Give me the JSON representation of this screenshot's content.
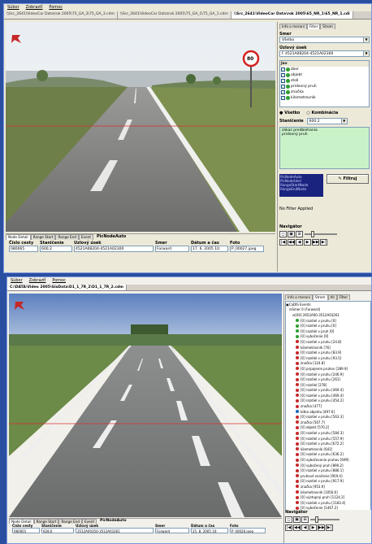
{
  "top_window": {
    "menu": [
      "Súbor",
      "Zobraziť",
      "Pomoc"
    ],
    "tabs": [
      "\\\\Src_2641\\VideoCar Data\\rok 2005\\75_GA_3\\75_GA_3.cdm",
      "\\\\Src_2641\\VideoCar Data\\rok 2005\\75_GA_1\\75_GA_1.cdm",
      "\\\\Src_2641\\VideoCar Data\\rok 2005\\65_NR_1\\65_NR_1.cdi"
    ],
    "panel": {
      "tabs": [
        "Info o meraní",
        "Filter",
        "Strom"
      ],
      "smer_label": "Smer",
      "smer_value": "Všetko",
      "usek_label": "Úzlový úsek",
      "usek_value": "F 4521A08204-4521A02300",
      "jav_header": "Jav",
      "jav_items": [
        "zbor",
        "objekt",
        "stoll",
        "pridavný pruh",
        "značka",
        "kilometrovník"
      ],
      "radio_all": "Všetko",
      "radio_combo": "Kombinácia",
      "staniccenie_label": "Staničenie",
      "staniccenie_value": "600.2",
      "note_lines": [
        "zákaz predbiehania",
        "pridavný pruh"
      ],
      "blue_lines": [
        "PicNodeAuto",
        "PicNodeUzel",
        "RangeStartNode",
        "RangeEndNode"
      ],
      "filter_button": "Filtruj",
      "no_filter": "No Filter Applied",
      "navigator_label": "Navigátor"
    },
    "bottom": {
      "tabs": [
        "Node Detail",
        "Range Start",
        "Range End",
        "Event"
      ],
      "title": "PicNodeAuto",
      "headers": [
        "Číslo cesty",
        "Staničenie",
        "Uzlový úsek",
        "Smer",
        "Dátum a čas",
        "Foto"
      ],
      "values": [
        "080065",
        "600.2",
        "4521A08204-4521A02300",
        "Forward",
        "17. 6. 2005 10:",
        "P_00027.jpeg"
      ]
    },
    "sign": "80"
  },
  "bottom_window": {
    "menu": [
      "Súbor",
      "Zobraziť",
      "Pomoc"
    ],
    "title": "C:\\DATA\\Video 2005\\GisData\\D1_1_7R_2\\D1_1_7R_2.cdm",
    "panel_tabs": [
      "Info o meraní",
      "Strom",
      "All",
      "Filter"
    ],
    "tree_root": "CaDIS Events",
    "tree_sub": "Smer 0 (Forward)",
    "tree_node": "[00] 2652A00-3512A03261",
    "events": [
      {
        "t": "[0] rozdiel v pruhu [0]",
        "c": "#2e9e2e"
      },
      {
        "t": "[0] rozdiel v pruhu [0]",
        "c": "#2e9e2e"
      },
      {
        "t": "[0] rozdiel v pruh [0]",
        "c": "#2e9e2e"
      },
      {
        "t": "[0] vybočenie [0]",
        "c": "#2e9e2e"
      },
      {
        "t": "[0] rozdiel v pruhu [24.8]",
        "c": "#c62828"
      },
      {
        "t": "kilometrovník [76]",
        "c": "#c62828"
      },
      {
        "t": "[0] rozdiel v pruhu [83.9]",
        "c": "#c62828"
      },
      {
        "t": "[0] rozdiel v pruhu [93.5]",
        "c": "#c62828"
      },
      {
        "t": "značka [124.8]",
        "c": "#c62828"
      },
      {
        "t": "[0] pripojenie pruhov [289.9]",
        "c": "#c62828"
      },
      {
        "t": "[0] rozdiel v pruhu [246.9]",
        "c": "#c62828"
      },
      {
        "t": "[0] rozdiel v pruhu [261]",
        "c": "#c62828"
      },
      {
        "t": "[0] rozdiel [278]",
        "c": "#c62828"
      },
      {
        "t": "[0] rozdiel v pruhu [469.4]",
        "c": "#c62828"
      },
      {
        "t": "[0] rozdiel v pruhu [469.4]",
        "c": "#c62828"
      },
      {
        "t": "[0] rozdiel v pruhu [454.2]",
        "c": "#c62828"
      },
      {
        "t": "značka [477]",
        "c": "#c62828"
      },
      {
        "t": "bitka objektu [497.6]",
        "c": "#1565c0"
      },
      {
        "t": "[0] rozdiel v pruhu [563.3]",
        "c": "#c62828"
      },
      {
        "t": "značka [567.7]",
        "c": "#c62828"
      },
      {
        "t": "[0] objekt [570.2]",
        "c": "#c62828"
      },
      {
        "t": "[0] rozdiel v pruhu [584.3]",
        "c": "#c62828"
      },
      {
        "t": "[0] rozdiel v pruhu [557.9]",
        "c": "#c62828"
      },
      {
        "t": "[0] rozdiel v pruhu [672.2]",
        "c": "#c62828"
      },
      {
        "t": "kilometrovník [641]",
        "c": "#c62828"
      },
      {
        "t": "[0] rozdiel v pruhu [636.2]",
        "c": "#c62828"
      },
      {
        "t": "[0] vybočovanie pruhov [699]",
        "c": "#c62828"
      },
      {
        "t": "[0] vybočený pruh [890.2]",
        "c": "#c62828"
      },
      {
        "t": "[0] rozdiel v pruhu [886.1]",
        "c": "#c62828"
      },
      {
        "t": "pruhové značenie [959.4]",
        "c": "#c62828"
      },
      {
        "t": "[0] rozdiel v pruhu [917.9]",
        "c": "#c62828"
      },
      {
        "t": "značka [953.9]",
        "c": "#c62828"
      },
      {
        "t": "kilometrovník [1056.6]",
        "c": "#c62828"
      },
      {
        "t": "[0] výstupný pruh [1124.2]",
        "c": "#c62828"
      },
      {
        "t": "[0] rozdiel v pruhu [1183.4]",
        "c": "#c62828"
      },
      {
        "t": "[0] vybočenie [1467.2]",
        "c": "#c62828"
      },
      {
        "t": "[0] rozdiel v pruhu [1581.4]",
        "c": "#c62828"
      },
      {
        "t": "kilometrovník [1606.3]",
        "c": "#c62828"
      },
      {
        "t": "[0] pripojenie pruhov [1612.6]",
        "c": "#c62828"
      },
      {
        "t": "[0] rozdiel v pruhu [1613.8]",
        "c": "#c62828"
      },
      {
        "t": "[0] rozdiel v pruhu [1681.8]",
        "c": "#c62828"
      },
      {
        "t": "[0] rozdiel v pruhu [1740.0]",
        "c": "#c62828"
      },
      {
        "t": "[0] rozdiel v pruhu [1761.8]",
        "c": "#c62828"
      },
      {
        "t": "[0] pripojenie pruhov [1910.1]",
        "c": "#c62828"
      },
      {
        "t": "[0] rozdiel v pruhu [1923.8]",
        "c": "#c62828"
      },
      {
        "t": "[0] rozdiel v pruhu [1983.4]",
        "c": "#c62828"
      }
    ],
    "navigator_label": "Navigátor",
    "bottom": {
      "tabs": [
        "Node Detail",
        "Range Start",
        "Range End",
        "Event"
      ],
      "title": "PicNodeAuto",
      "headers": [
        "Číslo cesty",
        "Staničenie",
        "Uzlový úsek",
        "Smer",
        "Dátum a čas",
        "Foto"
      ],
      "values": [
        "080001",
        "628.6",
        "3512A00350-3512A03261",
        "Forward",
        "25. 8. 2005 10:",
        "P_00026.jpeg"
      ]
    }
  },
  "colors": {
    "xp_blue": "#2a4fa0",
    "window_bg": "#ece9d8",
    "green_note": "#c9f2c9",
    "dark_blue_box": "#1a237e"
  }
}
